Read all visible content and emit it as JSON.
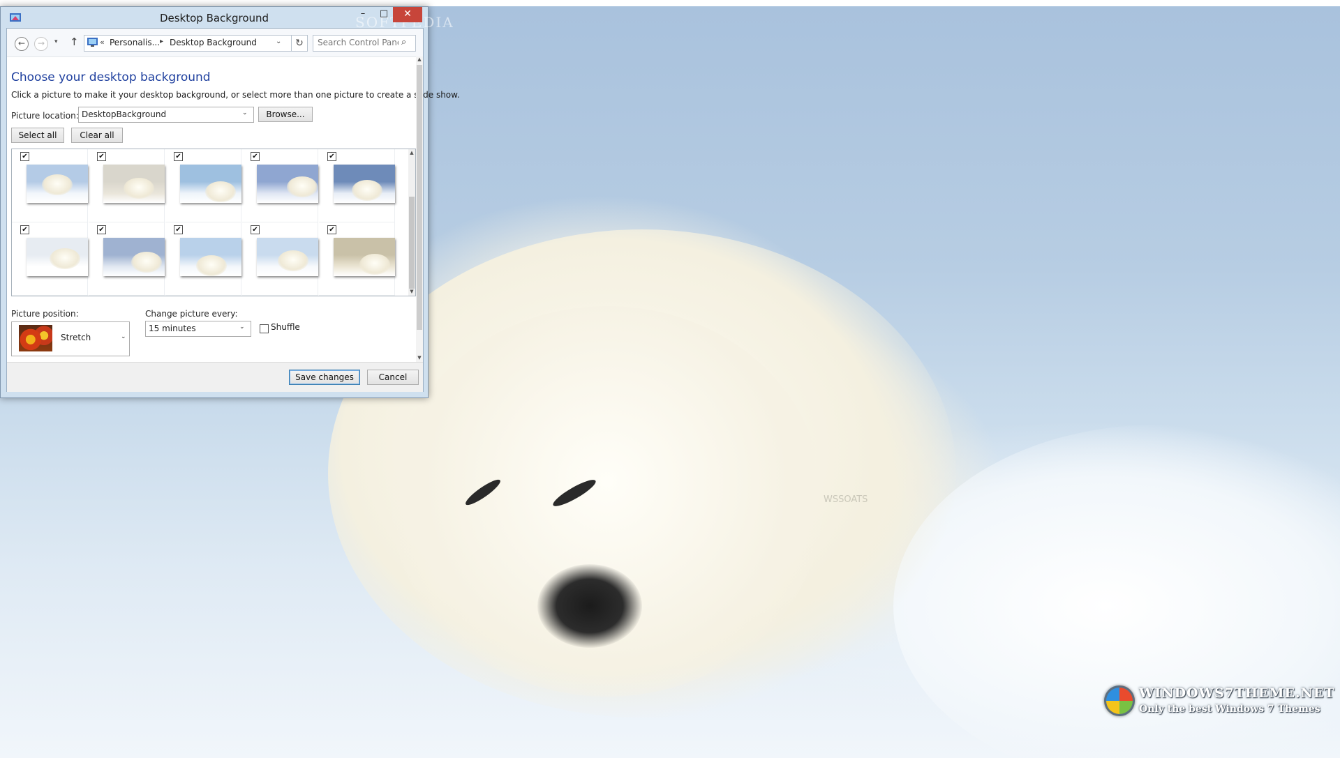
{
  "window": {
    "title": "Desktop Background",
    "controls": {
      "minimize": "–",
      "maximize": "□",
      "close": "✕"
    },
    "watermark": "SOFTPEDIA"
  },
  "nav": {
    "back_glyph": "←",
    "forward_glyph": "→",
    "recent_glyph": "▾",
    "up_glyph": "↑",
    "address": {
      "chevrons": "«",
      "crumbs": [
        "Personalis...",
        "Desktop Background"
      ],
      "separator": "▸",
      "dropdown_glyph": "⌄"
    },
    "refresh_glyph": "↻",
    "search": {
      "placeholder": "Search Control Panel",
      "icon_glyph": "⌕"
    }
  },
  "content": {
    "heading": "Choose your desktop background",
    "description": "Click a picture to make it your desktop background, or select more than one picture to create a slide show.",
    "picture_location": {
      "label": "Picture location:",
      "value": "DesktopBackground",
      "arrow": "⌄"
    },
    "browse_label": "Browse...",
    "select_all_label": "Select all",
    "clear_all_label": "Clear all",
    "gallery": {
      "items": [
        {
          "checked": true,
          "sky": "#b4cbe6",
          "snow": "#f2f6fb"
        },
        {
          "checked": true,
          "sky": "#d9d6cc",
          "snow": "#e9e5da"
        },
        {
          "checked": true,
          "sky": "#9ec0e0",
          "snow": "#eef4fa"
        },
        {
          "checked": true,
          "sky": "#8fa6d1",
          "snow": "#dfe6f3"
        },
        {
          "checked": true,
          "sky": "#6e8bb9",
          "snow": "#e7edf6"
        },
        {
          "checked": true,
          "sky": "#e7ecf2",
          "snow": "#ffffff"
        },
        {
          "checked": true,
          "sky": "#9fb2d1",
          "snow": "#e1e8f2"
        },
        {
          "checked": true,
          "sky": "#b9d1ea",
          "snow": "#f3f7fb"
        },
        {
          "checked": true,
          "sky": "#c9dbee",
          "snow": "#f7f9fc"
        },
        {
          "checked": true,
          "sky": "#c9c1a8",
          "snow": "#ece6d4"
        }
      ],
      "check_glyph": "✔"
    },
    "picture_position": {
      "label": "Picture position:",
      "value": "Stretch",
      "arrow": "⌄"
    },
    "change_picture": {
      "label": "Change picture every:",
      "value": "15 minutes",
      "arrow": "⌄"
    },
    "shuffle": {
      "label": "Shuffle",
      "checked": false
    }
  },
  "footer": {
    "save_label": "Save changes",
    "cancel_label": "Cancel"
  },
  "desktop": {
    "brand_name": "WINDOWS7THEME.NET",
    "brand_tagline": "Only the best Windows 7 Themes",
    "wallpaper_watermark": "WSSOATS"
  }
}
